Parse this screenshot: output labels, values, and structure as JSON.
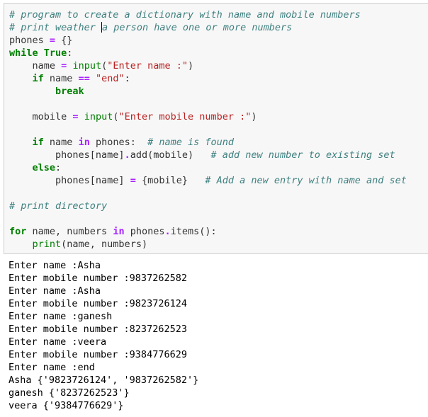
{
  "code_lines": [
    [
      {
        "c": "cm",
        "t": "# program to create a dictionary with name and mobile numbers"
      }
    ],
    [
      {
        "c": "cm",
        "t": "# print weather "
      },
      {
        "c": "cursor",
        "t": ""
      },
      {
        "c": "cm",
        "t": "a person have one or more numbers"
      }
    ],
    [
      {
        "c": "pl",
        "t": "phones "
      },
      {
        "c": "op",
        "t": "="
      },
      {
        "c": "pl",
        "t": " {}"
      }
    ],
    [
      {
        "c": "kw",
        "t": "while"
      },
      {
        "c": "pl",
        "t": " "
      },
      {
        "c": "kw",
        "t": "True"
      },
      {
        "c": "pl",
        "t": ":"
      }
    ],
    [
      {
        "c": "pl",
        "t": "    name "
      },
      {
        "c": "op",
        "t": "="
      },
      {
        "c": "pl",
        "t": " "
      },
      {
        "c": "bi",
        "t": "input"
      },
      {
        "c": "pl",
        "t": "("
      },
      {
        "c": "st",
        "t": "\"Enter name :\""
      },
      {
        "c": "pl",
        "t": ")"
      }
    ],
    [
      {
        "c": "pl",
        "t": "    "
      },
      {
        "c": "kw",
        "t": "if"
      },
      {
        "c": "pl",
        "t": " name "
      },
      {
        "c": "op",
        "t": "=="
      },
      {
        "c": "pl",
        "t": " "
      },
      {
        "c": "st",
        "t": "\"end\""
      },
      {
        "c": "pl",
        "t": ":"
      }
    ],
    [
      {
        "c": "pl",
        "t": "        "
      },
      {
        "c": "kw",
        "t": "break"
      }
    ],
    [],
    [
      {
        "c": "pl",
        "t": "    mobile "
      },
      {
        "c": "op",
        "t": "="
      },
      {
        "c": "pl",
        "t": " "
      },
      {
        "c": "bi",
        "t": "input"
      },
      {
        "c": "pl",
        "t": "("
      },
      {
        "c": "st",
        "t": "\"Enter mobile number :\""
      },
      {
        "c": "pl",
        "t": ")"
      }
    ],
    [],
    [
      {
        "c": "pl",
        "t": "    "
      },
      {
        "c": "kw",
        "t": "if"
      },
      {
        "c": "pl",
        "t": " name "
      },
      {
        "c": "op",
        "t": "in"
      },
      {
        "c": "pl",
        "t": " phones:  "
      },
      {
        "c": "cm",
        "t": "# name is found"
      }
    ],
    [
      {
        "c": "pl",
        "t": "        phones[name]"
      },
      {
        "c": "op",
        "t": "."
      },
      {
        "c": "pl",
        "t": "add(mobile)   "
      },
      {
        "c": "cm",
        "t": "# add new number to existing set"
      }
    ],
    [
      {
        "c": "pl",
        "t": "    "
      },
      {
        "c": "kw",
        "t": "else"
      },
      {
        "c": "pl",
        "t": ":"
      }
    ],
    [
      {
        "c": "pl",
        "t": "        phones[name] "
      },
      {
        "c": "op",
        "t": "="
      },
      {
        "c": "pl",
        "t": " {mobile}   "
      },
      {
        "c": "cm",
        "t": "# Add a new entry with name and set"
      }
    ],
    [],
    [
      {
        "c": "cm",
        "t": "# print directory"
      }
    ],
    [],
    [
      {
        "c": "kw",
        "t": "for"
      },
      {
        "c": "pl",
        "t": " name, numbers "
      },
      {
        "c": "op",
        "t": "in"
      },
      {
        "c": "pl",
        "t": " phones"
      },
      {
        "c": "op",
        "t": "."
      },
      {
        "c": "pl",
        "t": "items():"
      }
    ],
    [
      {
        "c": "pl",
        "t": "    "
      },
      {
        "c": "bi",
        "t": "print"
      },
      {
        "c": "pl",
        "t": "(name, numbers)"
      }
    ]
  ],
  "output_lines": [
    "Enter name :Asha",
    "Enter mobile number :9837262582",
    "Enter name :Asha",
    "Enter mobile number :9823726124",
    "Enter name :ganesh",
    "Enter mobile number :8237262523",
    "Enter name :veera",
    "Enter mobile number :9384776629",
    "Enter name :end",
    "Asha {'9823726124', '9837262582'}",
    "ganesh {'8237262523'}",
    "veera {'9384776629'}"
  ]
}
